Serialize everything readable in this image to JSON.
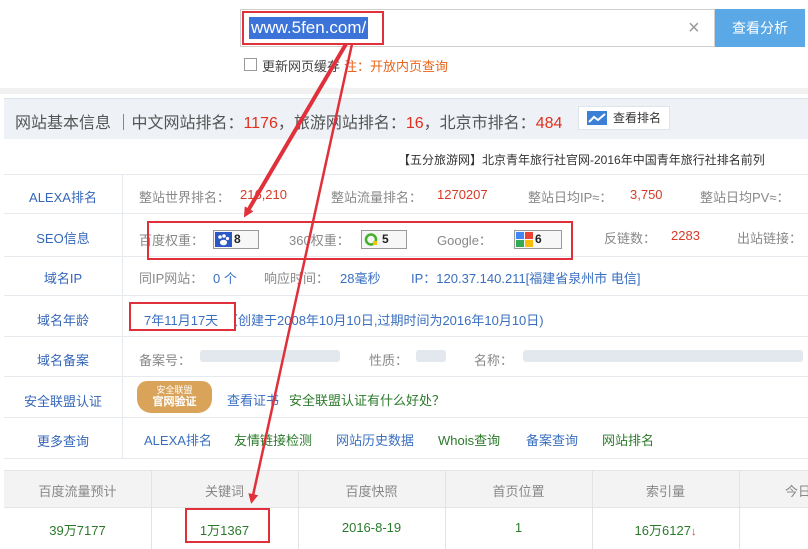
{
  "search": {
    "value": "www.5fen.com/",
    "button": "查看分析",
    "clear": "×"
  },
  "options": {
    "refresh": "更新网页缓存",
    "note": "注：开放内页查询"
  },
  "header": {
    "prefix": "网站基本信息 ｜中文网站排名：",
    "cn_rank": "1176",
    "mid1": "，旅游网站排名：",
    "travel_rank": "16",
    "mid2": "，北京市排名：",
    "beijing_rank": "484",
    "rank_button": "查看排名"
  },
  "site_title": "【五分旅游网】北京青年旅行社官网-2016年中国青年旅行社排名前列",
  "alexa": {
    "label": "ALEXA排名",
    "world_label": "整站世界排名：",
    "world_value": "216,210",
    "traffic_label": "整站流量排名：",
    "traffic_value": "1270207",
    "ip_label": "整站日均IP≈：",
    "ip_value": "3,750",
    "pv_label": "整站日均PV≈："
  },
  "seo": {
    "label": "SEO信息",
    "baidu_label": "百度权重：",
    "baidu_value": "8",
    "so360_label": "360权重：",
    "so360_value": "5",
    "google_label": "Google：",
    "google_value": "6",
    "backlinks_label": "反链数：",
    "backlinks_value": "2283",
    "outlinks_label": "出站链接："
  },
  "domain_ip": {
    "label": "域名IP",
    "same_ip_label": "同IP网站：",
    "same_ip_value": "0 个",
    "resp_label": "响应时间：",
    "resp_value": "28毫秒",
    "ip_text": "IP：120.37.140.211[福建省泉州市 电信]"
  },
  "domain_age": {
    "label": "域名年龄",
    "age": "7年11月17天",
    "detail": "（创建于2008年10月10日,过期时间为2016年10月10日)"
  },
  "icp": {
    "label": "域名备案",
    "no_label": "备案号：",
    "type_label": "性质：",
    "name_label": "名称："
  },
  "security": {
    "label": "安全联盟认证",
    "badge_top": "安全联盟",
    "badge_bottom": "官网验证",
    "view_cert": "查看证书",
    "benefit": "安全联盟认证有什么好处？"
  },
  "more": {
    "label": "更多查询",
    "links": [
      "ALEXA排名",
      "友情链接检测",
      "网站历史数据",
      "Whois查询",
      "备案查询",
      "网站排名"
    ]
  },
  "table": {
    "headers": [
      "百度流量预计",
      "关键词",
      "百度快照",
      "首页位置",
      "索引量",
      "今日"
    ],
    "values": [
      "39万7177",
      "1万1367",
      "2016-8-19",
      "1",
      "16万6127"
    ]
  },
  "colors": {
    "accent_red": "#e0303a",
    "link_blue": "#3a6fbf",
    "data_green": "#2b7a2b",
    "button_blue": "#5aa8e6"
  }
}
